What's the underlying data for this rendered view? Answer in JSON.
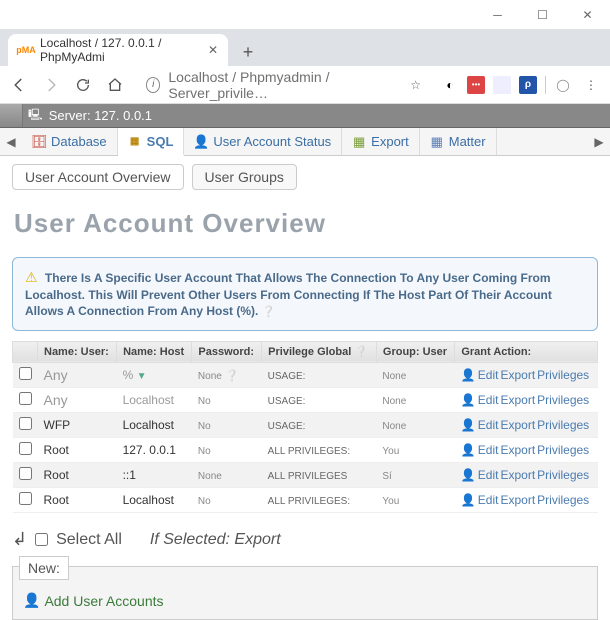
{
  "window": {
    "tab_title": "Localhost / 127. 0.0.1 / PhpMyAdmi"
  },
  "browser": {
    "url": "Localhost / Phpmyadmin / Server_privile…"
  },
  "server": {
    "label": "Server: 127. 0.0.1"
  },
  "pma_tabs": {
    "database": "Database",
    "sql": "SQL",
    "status": "User Account Status",
    "export": "Export",
    "matter": "Matter"
  },
  "subtabs": {
    "overview": "User Account Overview",
    "groups": "User Groups"
  },
  "heading": "User Account Overview",
  "notice": "There Is A Specific User Account That Allows The Connection To Any User Coming From Localhost. This Will Prevent Other Users From Connecting If The Host Part Of Their Account Allows A Connection From Any Host (%).",
  "headers": {
    "user": "Name: User:",
    "host": "Name: Host",
    "pass": "Password:",
    "priv": "Privilege Global",
    "group": "Group: User",
    "action": "Grant Action:"
  },
  "rows": [
    {
      "user": "Any",
      "host": "%",
      "pass": "None",
      "priv": "USAGE:",
      "group": "None"
    },
    {
      "user": "Any",
      "host": "Localhost",
      "pass": "No",
      "priv": "USAGE:",
      "group": "None"
    },
    {
      "user": "WFP",
      "host": "Localhost",
      "pass": "No",
      "priv": "USAGE:",
      "group": "None"
    },
    {
      "user": "Root",
      "host": "127. 0.0.1",
      "pass": "No",
      "priv": "ALL PRIVILEGES:",
      "group": "You"
    },
    {
      "user": "Root",
      "host": "::1",
      "pass": "None",
      "priv": "ALL PRIVILEGES",
      "group": "Sí"
    },
    {
      "user": "Root",
      "host": "Localhost",
      "pass": "No",
      "priv": "ALL PRIVILEGES:",
      "group": "You"
    }
  ],
  "action_labels": {
    "edit": "Edit",
    "export": "Export",
    "priv": "Privileges"
  },
  "footer": {
    "select_all": "Select All",
    "if_selected": "If Selected: Export"
  },
  "newbox": {
    "label": "New:",
    "add": "Add User Accounts"
  }
}
